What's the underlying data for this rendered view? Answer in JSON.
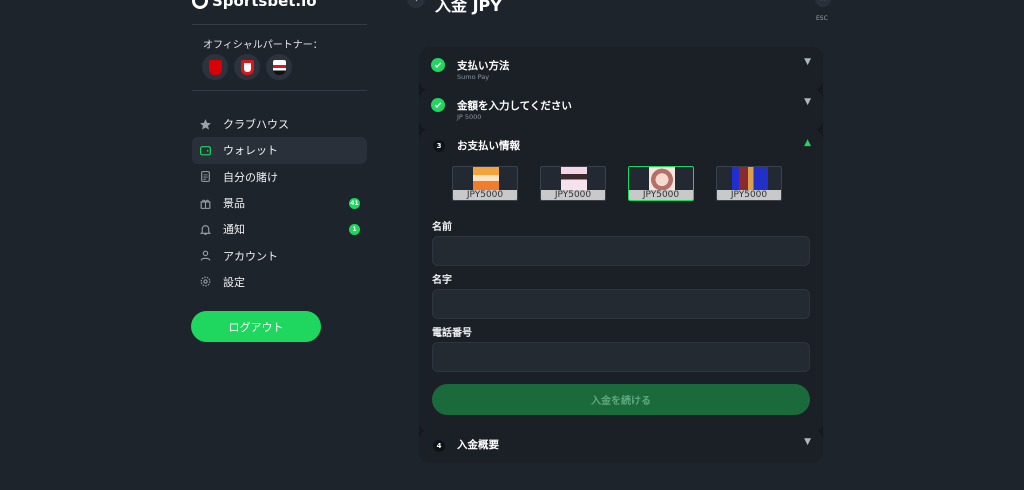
{
  "brand": {
    "name": "Sportsbet.io"
  },
  "partners": {
    "title": "オフィシャルパートナー：",
    "clubs": [
      {
        "icon": "arsenal-crest-icon",
        "color": "#db0007"
      },
      {
        "icon": "southampton-crest-icon",
        "color": "#d71920"
      },
      {
        "icon": "sao-paulo-crest-icon",
        "color": "#ffffff"
      }
    ]
  },
  "sidebar": {
    "items": [
      {
        "label": "クラブハウス",
        "icon": "star-icon"
      },
      {
        "label": "ウォレット",
        "icon": "wallet-icon",
        "active": true
      },
      {
        "label": "自分の賭け",
        "icon": "bet-slip-icon"
      },
      {
        "label": "景品",
        "icon": "gift-icon",
        "count": "41"
      },
      {
        "label": "通知",
        "icon": "bell-icon",
        "count": "1"
      },
      {
        "label": "アカウント",
        "icon": "user-icon"
      },
      {
        "label": "設定",
        "icon": "gear-icon"
      }
    ],
    "logout_label": "ログアウト"
  },
  "deposit": {
    "title": "入金 JPY",
    "esc_label": "ESC",
    "steps": [
      {
        "title": "支払い方法",
        "subtitle": "Sumo Pay",
        "status": "done"
      },
      {
        "title": "金額を入力してください",
        "subtitle": "JP 5000",
        "status": "done"
      },
      {
        "number": "3",
        "title": "お支払い情報",
        "status": "open"
      },
      {
        "number": "4",
        "title": "入金概要",
        "status": "collapsed"
      }
    ],
    "cards": [
      {
        "caption": "JPY5000",
        "selected": false
      },
      {
        "caption": "JPY5000",
        "selected": false
      },
      {
        "caption": "JPY5000",
        "selected": true
      },
      {
        "caption": "JPY5000",
        "selected": false
      }
    ],
    "form": {
      "first_name_label": "名前",
      "first_name_value": "",
      "last_name_label": "名字",
      "last_name_value": "",
      "phone_label": "電話番号",
      "phone_value": ""
    },
    "submit_label": "入金を続ける"
  },
  "colors": {
    "accent": "#1fd65f",
    "background": "#1e242c",
    "panel": "#15191e"
  }
}
